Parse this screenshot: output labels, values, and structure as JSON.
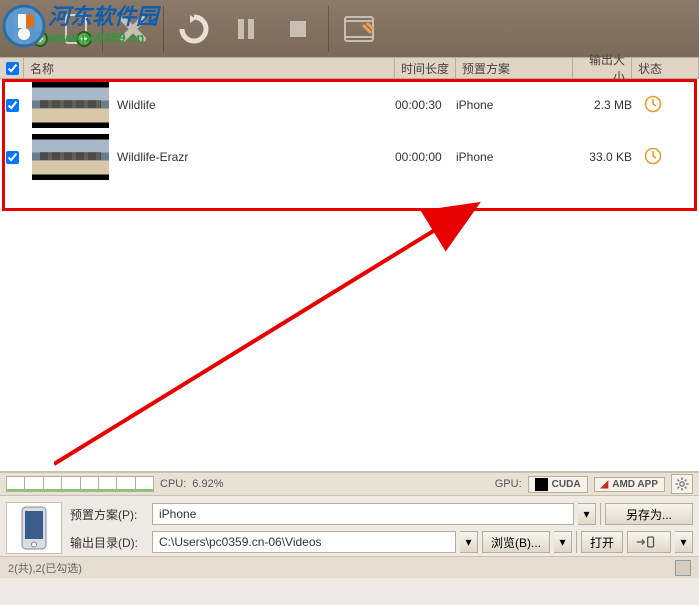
{
  "watermark": {
    "brand": "河东软件园",
    "url": "www.pc0359.cn"
  },
  "columns": {
    "check": "",
    "name": "名称",
    "duration": "时间长度",
    "preset": "预置方案",
    "size": "输出大小",
    "status": "状态"
  },
  "rows": [
    {
      "checked": true,
      "name": "Wildlife",
      "duration": "00:00:30",
      "preset": "iPhone",
      "size": "2.3 MB",
      "status": "pending"
    },
    {
      "checked": true,
      "name": "Wildlife-Erazr",
      "duration": "00:00:00",
      "preset": "iPhone",
      "size": "33.0 KB",
      "status": "pending"
    }
  ],
  "meters": {
    "cpu_label": "CPU:",
    "cpu_value": "6.92%",
    "gpu_label": "GPU:",
    "cuda": "CUDA",
    "amd": "AMD APP"
  },
  "form": {
    "preset_label": "预置方案(P):",
    "preset_value": "iPhone",
    "save_as": "另存为...",
    "output_label": "输出目录(D):",
    "output_value": "C:\\Users\\pc0359.cn-06\\Videos",
    "browse": "浏览(B)...",
    "open": "打开"
  },
  "statusbar": {
    "text": "2(共),2(已勾选)"
  }
}
